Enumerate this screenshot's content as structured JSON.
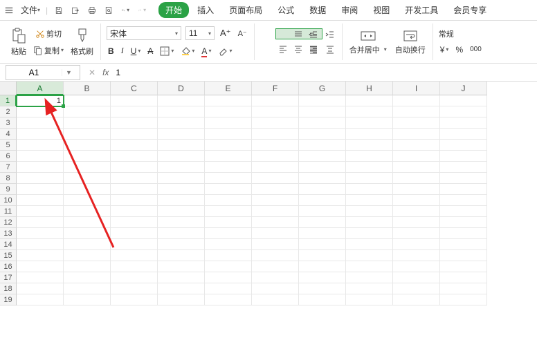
{
  "menu": {
    "file": "文件",
    "tabs": [
      "开始",
      "插入",
      "页面布局",
      "公式",
      "数据",
      "审阅",
      "视图",
      "开发工具",
      "会员专享"
    ],
    "active_tab_index": 0
  },
  "clipboard": {
    "paste": "粘贴",
    "cut": "剪切",
    "copy": "复制",
    "format_painter": "格式刷"
  },
  "font": {
    "name": "宋体",
    "size": "11"
  },
  "merge": {
    "merge_center": "合并居中",
    "wrap_text": "自动换行"
  },
  "number_format": {
    "general": "常规",
    "percent": "%",
    "thousand": "000"
  },
  "namebox": "A1",
  "formula_value": "1",
  "columns": [
    "A",
    "B",
    "C",
    "D",
    "E",
    "F",
    "G",
    "H",
    "I",
    "J"
  ],
  "row_count": 19,
  "selected_col": "A",
  "selected_row": 1,
  "cells": {
    "A1": "1"
  }
}
